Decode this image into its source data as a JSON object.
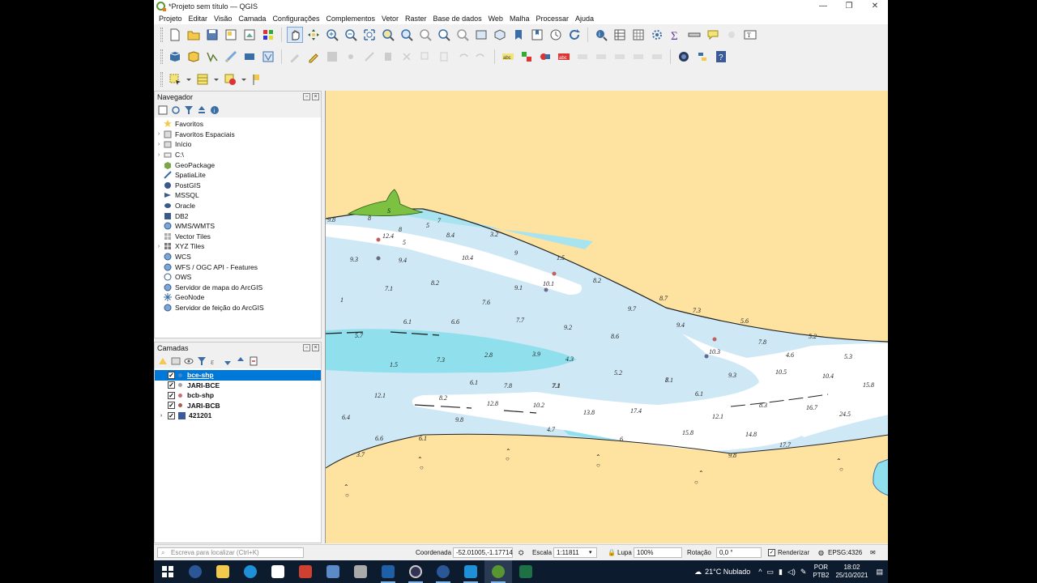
{
  "window": {
    "title": "*Projeto sem título — QGIS"
  },
  "menu": [
    "Projeto",
    "Editar",
    "Visão",
    "Camada",
    "Configurações",
    "Complementos",
    "Vetor",
    "Raster",
    "Base de dados",
    "Web",
    "Malha",
    "Processar",
    "Ajuda"
  ],
  "navigator": {
    "title": "Navegador",
    "items": [
      {
        "label": "Favoritos",
        "icon": "star-icon",
        "expand": false
      },
      {
        "label": "Favoritos Espaciais",
        "icon": "bookmark-icon",
        "expand": true
      },
      {
        "label": "Início",
        "icon": "folder-icon",
        "expand": true
      },
      {
        "label": "C:\\",
        "icon": "drive-icon",
        "expand": true
      },
      {
        "label": "GeoPackage",
        "icon": "geopackage-icon",
        "expand": false
      },
      {
        "label": "SpatiaLite",
        "icon": "spatialite-icon",
        "expand": false
      },
      {
        "label": "PostGIS",
        "icon": "postgis-icon",
        "expand": false
      },
      {
        "label": "MSSQL",
        "icon": "mssql-icon",
        "expand": false
      },
      {
        "label": "Oracle",
        "icon": "oracle-icon",
        "expand": false
      },
      {
        "label": "DB2",
        "icon": "db2-icon",
        "expand": false
      },
      {
        "label": "WMS/WMTS",
        "icon": "globe-icon",
        "expand": false
      },
      {
        "label": "Vector Tiles",
        "icon": "grid-icon",
        "expand": false
      },
      {
        "label": "XYZ Tiles",
        "icon": "grid-icon",
        "expand": true
      },
      {
        "label": "WCS",
        "icon": "globe-icon",
        "expand": false
      },
      {
        "label": "WFS / OGC API - Features",
        "icon": "globe-icon",
        "expand": false
      },
      {
        "label": "OWS",
        "icon": "globe-icon",
        "expand": false
      },
      {
        "label": "Servidor de mapa do ArcGIS",
        "icon": "globe-icon",
        "expand": false
      },
      {
        "label": "GeoNode",
        "icon": "geonode-icon",
        "expand": false
      },
      {
        "label": "Servidor de feição do ArcGIS",
        "icon": "globe-icon",
        "expand": false
      }
    ]
  },
  "layers": {
    "title": "Camadas",
    "items": [
      {
        "label": "bce-shp",
        "checked": true,
        "selected": true,
        "color": "#4a86c8",
        "type": "point"
      },
      {
        "label": "JARI-BCE",
        "checked": true,
        "selected": false,
        "color": "#b0a0a0",
        "type": "point"
      },
      {
        "label": "bcb-shp",
        "checked": true,
        "selected": false,
        "color": "#c87070",
        "type": "point"
      },
      {
        "label": "JARI-BCB",
        "checked": true,
        "selected": false,
        "color": "#a06050",
        "type": "point"
      },
      {
        "label": "421201",
        "checked": true,
        "selected": false,
        "color": "#3a5a9a",
        "type": "raster"
      }
    ]
  },
  "map": {
    "depth_labels": [
      "9.8",
      "8",
      "S",
      "7",
      "5",
      "8.4",
      "3.2",
      "12.4",
      "8",
      "5",
      "9.3",
      "9.4",
      "10.4",
      "9",
      "1.5",
      "8.2",
      "10.1",
      "9.1",
      "7.1",
      "8.2",
      "7.6",
      "9.7",
      "8.7",
      "7.3",
      "5.6",
      "6.1",
      "6.6",
      "7.7",
      "9.2",
      "8.6",
      "9.4",
      "5.2",
      "5.7",
      "7.3",
      "2.8",
      "3.9",
      "4.3",
      "1.5",
      "10.3",
      "7.8",
      "4.6",
      "5.2",
      "6.1",
      "10.5",
      "10.4",
      "9.3",
      "5.3",
      "7.8",
      "8.1",
      "6.1",
      "7.1",
      "8.2",
      "12.1",
      "12.8",
      "10.2",
      "13.8",
      "17.4",
      "12.1",
      "8.3",
      "16.7",
      "24.5",
      "15.8",
      "6.4",
      "9.8",
      "4.7",
      "6.6",
      "6.1",
      "3.7",
      "15.8",
      "14.8",
      "17.7",
      "6",
      "9.8",
      "1",
      "7",
      "7.1"
    ]
  },
  "status": {
    "search_placeholder": "Escreva para localizar (Ctrl+K)",
    "coord_label": "Coordenada",
    "coord_value": "-52.01005,-1.17714",
    "scale_label": "Escala",
    "scale_value": "1:11811",
    "magnifier_label": "Lupa",
    "magnifier_value": "100%",
    "rotation_label": "Rotação",
    "rotation_value": "0,0 °",
    "render_label": "Renderizar",
    "crs": "EPSG:4326"
  },
  "taskbar": {
    "weather": "21°C  Nublado",
    "lang_top": "POR",
    "lang_bottom": "PTB2",
    "time": "18:02",
    "date": "25/10/2021"
  }
}
